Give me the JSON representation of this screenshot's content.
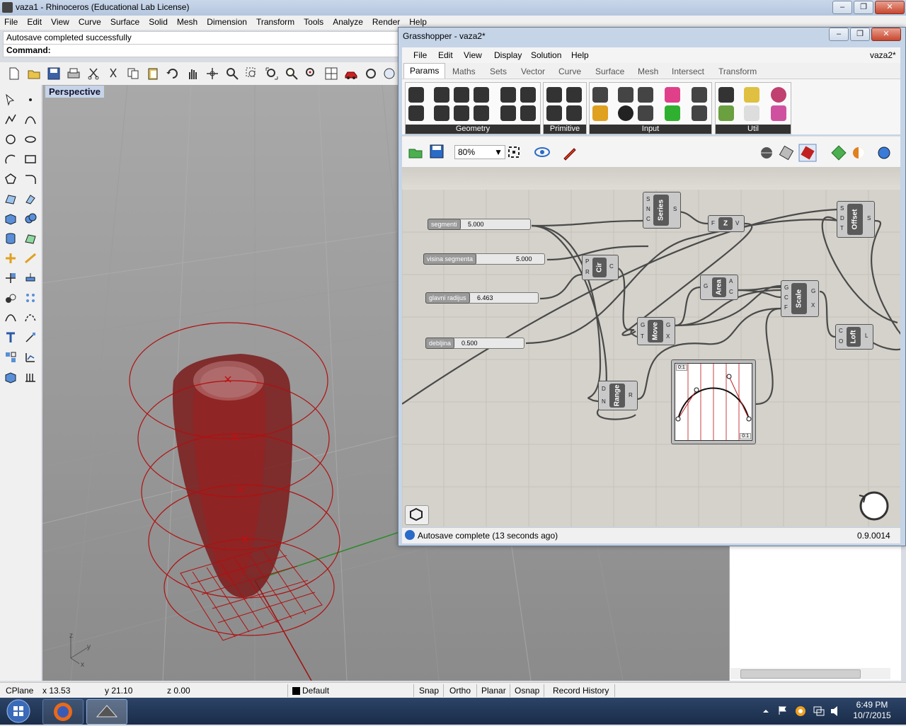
{
  "rhino": {
    "title": "vaza1 - Rhinoceros (Educational Lab License)",
    "menu": [
      "File",
      "Edit",
      "View",
      "Curve",
      "Surface",
      "Solid",
      "Mesh",
      "Dimension",
      "Transform",
      "Tools",
      "Analyze",
      "Render",
      "Help"
    ],
    "command_history": "Autosave completed successfully",
    "command_prompt": "Command:",
    "viewport_label": "Perspective",
    "status": {
      "cplane": "CPlane",
      "x": "x 13.53",
      "y": "y 21.10",
      "z": "z 0.00",
      "layer": "Default",
      "snap": "Snap",
      "ortho": "Ortho",
      "planar": "Planar",
      "osnap": "Osnap",
      "record_history": "Record History"
    },
    "axis": {
      "x": "x",
      "y": "y",
      "z": "z"
    }
  },
  "grasshopper": {
    "title": "Grasshopper - vaza2*",
    "doc_name": "vaza2*",
    "menu": [
      "File",
      "Edit",
      "View",
      "Display",
      "Solution",
      "Help"
    ],
    "tabs": [
      "Params",
      "Maths",
      "Sets",
      "Vector",
      "Curve",
      "Surface",
      "Mesh",
      "Intersect",
      "Transform"
    ],
    "active_tab": "Params",
    "ribbon_groups": [
      "Geometry",
      "Primitive",
      "Input",
      "Util"
    ],
    "zoom": "80%",
    "status_text": "Autosave complete (13 seconds ago)",
    "version": "0.9.0014",
    "sliders": [
      {
        "label": "segmenti",
        "value": "5.000"
      },
      {
        "label": "visina segmenta",
        "value": "5.000"
      },
      {
        "label": "glavni radijus",
        "value": "6.463"
      },
      {
        "label": "debljina",
        "value": "0.500"
      }
    ],
    "components": {
      "series": {
        "name": "Series",
        "inputs": [
          "S",
          "N",
          "C"
        ],
        "outputs": [
          "S"
        ]
      },
      "z": {
        "name": "Z",
        "inputs": [
          "F"
        ],
        "outputs": [
          "V"
        ]
      },
      "offset": {
        "name": "Offset",
        "inputs": [
          "S",
          "D",
          "T"
        ],
        "outputs": [
          "S"
        ]
      },
      "cir": {
        "name": "Cir",
        "inputs": [
          "P",
          "R"
        ],
        "outputs": [
          "C"
        ]
      },
      "area": {
        "name": "Area",
        "inputs": [
          "G"
        ],
        "outputs": [
          "A",
          "C"
        ]
      },
      "scale": {
        "name": "Scale",
        "inputs": [
          "G",
          "C",
          "F"
        ],
        "outputs": [
          "G",
          "X"
        ]
      },
      "move": {
        "name": "Move",
        "inputs": [
          "G",
          "T"
        ],
        "outputs": [
          "G",
          "X"
        ]
      },
      "loft": {
        "name": "Loft",
        "inputs": [
          "C",
          "O"
        ],
        "outputs": [
          "L"
        ]
      },
      "range": {
        "name": "Range",
        "inputs": [
          "D",
          "N"
        ],
        "outputs": [
          "R"
        ]
      }
    },
    "graph_mapper": {
      "corner_top": "0:1",
      "corner_bottom": "0:1"
    }
  },
  "taskbar": {
    "time": "6:49 PM",
    "date": "10/7/2015"
  }
}
